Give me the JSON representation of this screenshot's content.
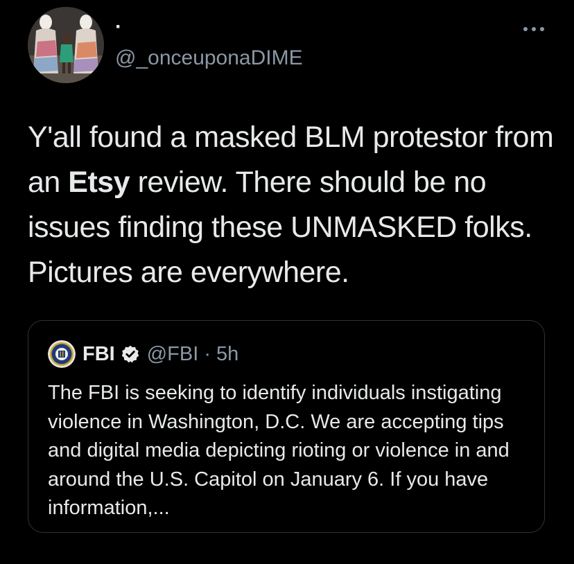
{
  "tweet": {
    "author": {
      "display_name": "·",
      "handle": "@_onceuponaDIME",
      "avatar": "avatar-photo"
    },
    "menu_icon": "more-icon",
    "text": {
      "before_bold": "Y'all found a masked BLM protestor from an ",
      "bold": "Etsy",
      "after_bold": " review. There should be no issues finding these UNMASKED folks. Pictures are everywhere."
    }
  },
  "quoted_tweet": {
    "avatar_icon": "fbi-seal-icon",
    "name": "FBI",
    "verified_icon": "verified-badge-icon",
    "handle_time": "@FBI · 5h",
    "text": "The FBI is seeking to identify individuals instigating violence in Washington, D.C. We are accepting tips and digital media depicting rioting or violence in and around the U.S. Capitol on January 6. If you have information,..."
  },
  "colors": {
    "background": "#000000",
    "primary_text": "#e7e9ea",
    "secondary_text": "#8b98a5",
    "card_border": "#2f3336"
  }
}
